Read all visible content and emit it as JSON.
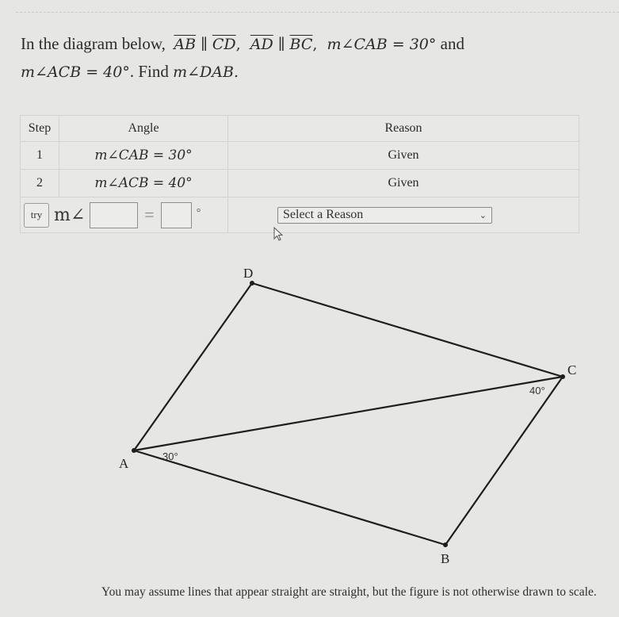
{
  "question": {
    "intro": "In the diagram below,",
    "seg1": "AB",
    "seg2": "CD",
    "seg3": "AD",
    "seg4": "BC",
    "parallel_symbol": "∥",
    "given1": "m∠CAB = 30°",
    "and": "and",
    "given2": "m∠ACB = 40°",
    "find_prefix": ". Find",
    "find_target": "m∠DAB."
  },
  "table": {
    "headers": {
      "step": "Step",
      "angle": "Angle",
      "reason": "Reason"
    },
    "rows": [
      {
        "step": "1",
        "angle": "m∠CAB = 30°",
        "reason": "Given"
      },
      {
        "step": "2",
        "angle": "m∠ACB = 40°",
        "reason": "Given"
      }
    ],
    "try_row": {
      "try_label": "try",
      "angle_prefix": "m∠",
      "vertex_value": "",
      "equals": "=",
      "degree_value": "",
      "degree_symbol": "°",
      "reason_select": "Select a Reason"
    }
  },
  "diagram": {
    "vertices": {
      "A": "A",
      "B": "B",
      "C": "C",
      "D": "D"
    },
    "angle_labels": {
      "A": "30°",
      "C": "40°"
    }
  },
  "footnote": "You may assume lines that appear straight are straight, but the figure is not otherwise drawn to scale."
}
